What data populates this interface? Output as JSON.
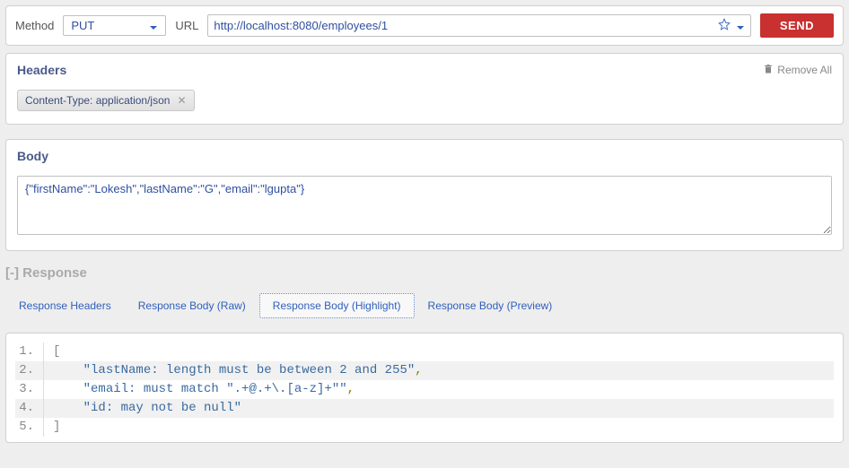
{
  "request": {
    "method_label": "Method",
    "method_value": "PUT",
    "url_label": "URL",
    "url_value": "http://localhost:8080/employees/1",
    "send_label": "SEND"
  },
  "headers_panel": {
    "title": "Headers",
    "remove_all": "Remove All",
    "tags": [
      {
        "text": "Content-Type: application/json"
      }
    ]
  },
  "body_panel": {
    "title": "Body",
    "content": "{\"firstName\":\"Lokesh\",\"lastName\":\"G\",\"email\":\"lgupta\"}"
  },
  "response": {
    "title": "[-] Response",
    "tabs": [
      {
        "label": "Response Headers",
        "active": false
      },
      {
        "label": "Response Body (Raw)",
        "active": false
      },
      {
        "label": "Response Body (Highlight)",
        "active": true
      },
      {
        "label": "Response Body (Preview)",
        "active": false
      }
    ],
    "code_lines": [
      {
        "n": "1.",
        "prefix": "[",
        "prefix_class": "tok-punc",
        "content": "",
        "content_class": "",
        "suffix": "",
        "hl": false
      },
      {
        "n": "2.",
        "prefix": "    ",
        "prefix_class": "",
        "content": "\"lastName: length must be between 2 and 255\"",
        "content_class": "tok-str",
        "suffix": ",",
        "hl": true
      },
      {
        "n": "3.",
        "prefix": "    ",
        "prefix_class": "",
        "content": "\"email: must match \".+@.+\\.[a-z]+\"\"",
        "content_class": "tok-str",
        "suffix": ",",
        "hl": false
      },
      {
        "n": "4.",
        "prefix": "    ",
        "prefix_class": "",
        "content": "\"id: may not be null\"",
        "content_class": "tok-str",
        "suffix": "",
        "hl": true
      },
      {
        "n": "5.",
        "prefix": "]",
        "prefix_class": "tok-punc",
        "content": "",
        "content_class": "",
        "suffix": "",
        "hl": false
      }
    ]
  }
}
